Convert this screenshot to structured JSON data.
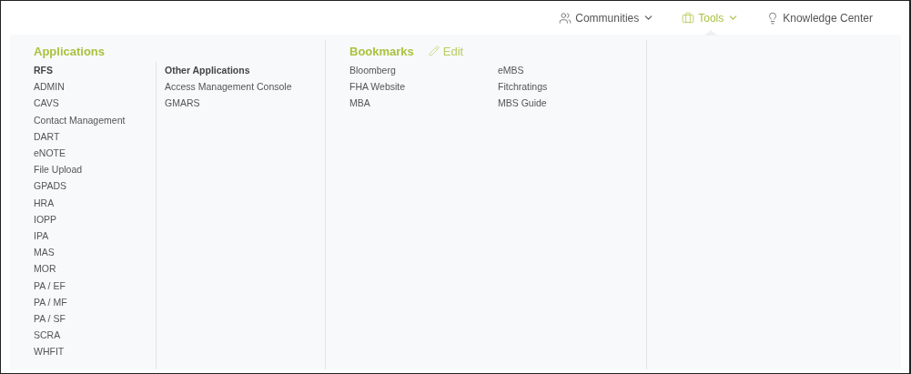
{
  "nav": [
    {
      "label": "Communities",
      "dropdown": true,
      "selected": false
    },
    {
      "label": "Tools",
      "dropdown": true,
      "selected": true
    },
    {
      "label": "Knowledge Center",
      "dropdown": false,
      "selected": false
    }
  ],
  "applications": {
    "title": "Applications",
    "groups": [
      {
        "heading": "RFS",
        "items": [
          "ADMIN",
          "CAVS",
          "Contact Management",
          "DART",
          "eNOTE",
          "File Upload",
          "GPADS",
          "HRA",
          "IOPP",
          "IPA",
          "MAS",
          "MOR",
          "PA / EF",
          "PA / MF",
          "PA / SF",
          "SCRA",
          "WHFIT"
        ]
      },
      {
        "heading": "Other Applications",
        "items": [
          "Access Management Console",
          "GMARS"
        ]
      }
    ]
  },
  "bookmarks": {
    "title": "Bookmarks",
    "edit": "Edit",
    "columns": [
      [
        "Bloomberg",
        "FHA Website",
        "MBA"
      ],
      [
        "eMBS",
        "Fitchratings",
        "MBS Guide"
      ]
    ]
  }
}
